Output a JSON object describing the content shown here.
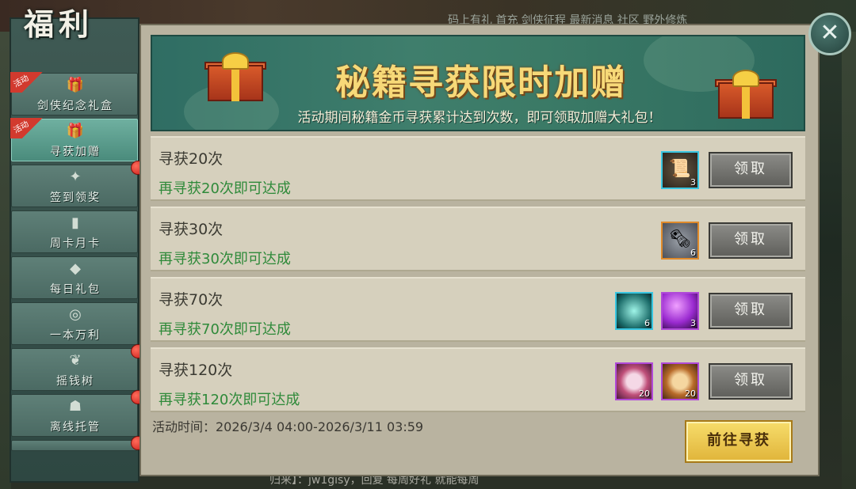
{
  "window": {
    "title": "福利"
  },
  "background": {
    "ticker": "码上有礼    首充    剑侠征程 最新消息    社区    野外修炼",
    "chat": "归来】：jw1gisy，回复  每周好礼  就能每周"
  },
  "sidebar": {
    "items": [
      {
        "label": "剑侠纪念礼盒",
        "tag": "活动",
        "active": false,
        "dot": false
      },
      {
        "label": "寻获加赠",
        "tag": "活动",
        "active": true,
        "dot": false
      },
      {
        "label": "签到领奖",
        "tag": "",
        "active": false,
        "dot": true
      },
      {
        "label": "周卡月卡",
        "tag": "",
        "active": false,
        "dot": false
      },
      {
        "label": "每日礼包",
        "tag": "",
        "active": false,
        "dot": false
      },
      {
        "label": "一本万利",
        "tag": "",
        "active": false,
        "dot": false
      },
      {
        "label": "摇钱树",
        "tag": "",
        "active": false,
        "dot": true
      },
      {
        "label": "离线托管",
        "tag": "",
        "active": false,
        "dot": true
      },
      {
        "label": "",
        "tag": "",
        "active": false,
        "dot": true
      }
    ]
  },
  "banner": {
    "title": "秘籍寻获限时加赠",
    "subtitle": "活动期间秘籍金币寻获累计达到次数，即可领取加赠大礼包！"
  },
  "rewards": [
    {
      "title": "寻获20次",
      "status": "再寻获20次即可达成",
      "button": "领取",
      "items": [
        {
          "icon": "scroll-icon",
          "count": "3"
        }
      ]
    },
    {
      "title": "寻获30次",
      "status": "再寻获30次即可达成",
      "button": "领取",
      "items": [
        {
          "icon": "parchment-icon",
          "count": "6"
        }
      ]
    },
    {
      "title": "寻获70次",
      "status": "再寻获70次即可达成",
      "button": "领取",
      "items": [
        {
          "icon": "jade-orb-icon",
          "count": "6"
        },
        {
          "icon": "purple-orb-icon",
          "count": "3"
        }
      ]
    },
    {
      "title": "寻获120次",
      "status": "再寻获120次即可达成",
      "button": "领取",
      "items": [
        {
          "icon": "pink-mirror-icon",
          "count": "20"
        },
        {
          "icon": "gold-mirror-icon",
          "count": "20"
        }
      ]
    }
  ],
  "footer": {
    "time_label": "活动时间：2026/3/4 04:00-2026/3/11 03:59",
    "go_button": "前往寻获"
  },
  "colors": {
    "status_green": "#2f8a3a",
    "banner_gold": "#f7d978",
    "active_tab": "#4a8b7c"
  }
}
